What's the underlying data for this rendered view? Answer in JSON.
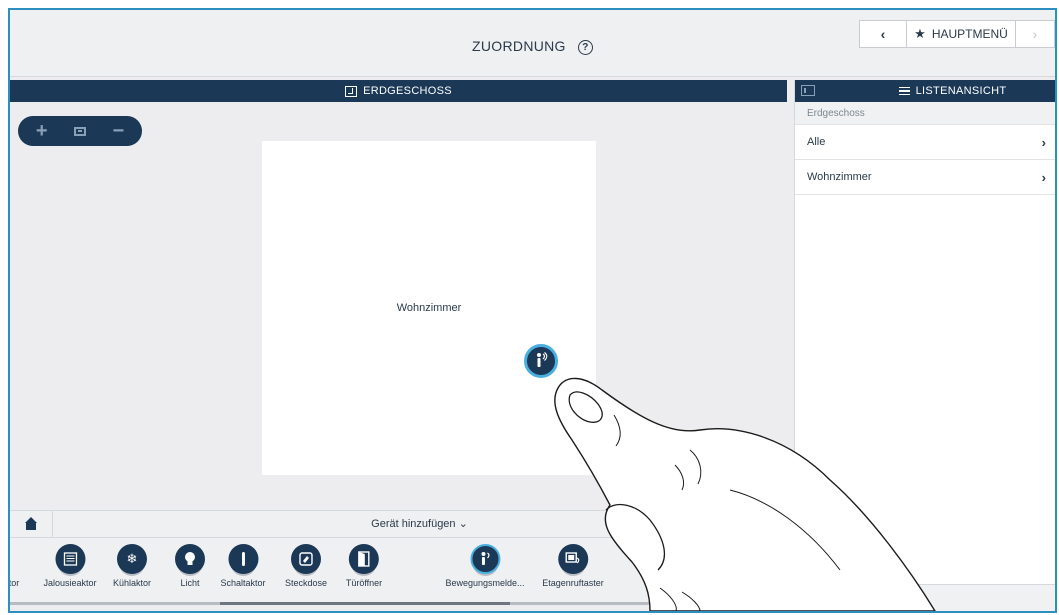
{
  "header": {
    "title": "ZUORDNUNG",
    "help_glyph": "?",
    "back_glyph": "‹",
    "main_menu_label": "HAUPTMENÜ",
    "forward_glyph": "›"
  },
  "floorplan": {
    "floor_title": "ERDGESCHOSS",
    "zoom_in": "+",
    "zoom_out": "−",
    "room_name": "Wohnzimmer"
  },
  "list_panel": {
    "title": "LISTENANSICHT",
    "section": "Erdgeschoss",
    "items": [
      {
        "label": "Alle"
      },
      {
        "label": "Wohnzimmer"
      }
    ]
  },
  "add_device": {
    "label": "Gerät hinzufügen",
    "chevron": "⌄"
  },
  "devices": [
    {
      "label": "tor",
      "icon": "partial-icon"
    },
    {
      "label": "Jalousieaktor",
      "icon": "blind-icon"
    },
    {
      "label": "Kühlaktor",
      "icon": "snowflake-icon"
    },
    {
      "label": "Licht",
      "icon": "bulb-icon"
    },
    {
      "label": "Schaltaktor",
      "icon": "switch-icon"
    },
    {
      "label": "Steckdose",
      "icon": "socket-icon"
    },
    {
      "label": "Türöffner",
      "icon": "door-icon"
    },
    {
      "label": "Bewegungsmelde...",
      "icon": "motion-sensor-icon"
    },
    {
      "label": "Etagenruftaster",
      "icon": "floor-call-icon"
    }
  ],
  "colors": {
    "accent": "#49aee0",
    "navy": "#1b3857",
    "frame": "#2c8fc0"
  }
}
